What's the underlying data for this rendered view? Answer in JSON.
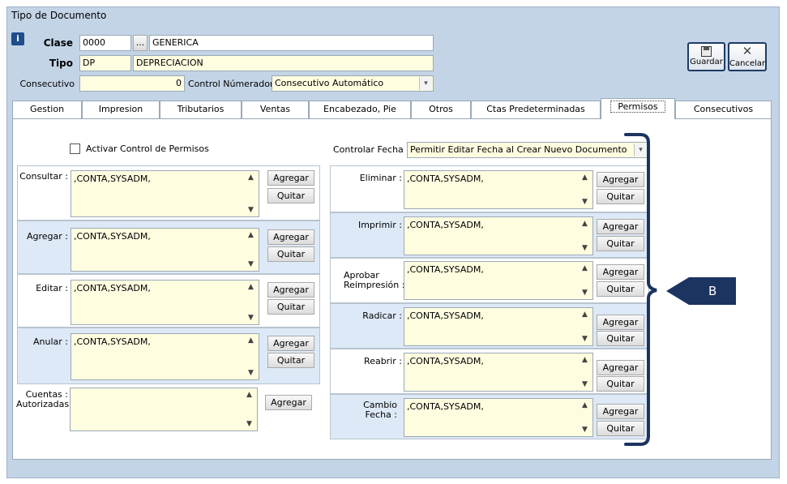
{
  "window": {
    "title": "Tipo de Documento"
  },
  "header": {
    "clase_label": "Clase",
    "clase_code": "0000",
    "clase_lookup_label": "...",
    "clase_name": "GENERICA",
    "tipo_label": "Tipo",
    "tipo_code": "DP",
    "tipo_name": "DEPRECIACION",
    "consecutivo_label": "Consecutivo",
    "consecutivo_value": "0",
    "control_numerador_label": "Control Númerador :",
    "control_numerador_value": "Consecutivo Automático"
  },
  "toolbar": {
    "guardar_label": "Guardar",
    "cancelar_label": "Cancelar"
  },
  "tabs": [
    {
      "label": "Gestion"
    },
    {
      "label": "Impresion"
    },
    {
      "label": "Tributarios"
    },
    {
      "label": "Ventas"
    },
    {
      "label": "Encabezado, Pie"
    },
    {
      "label": "Otros"
    },
    {
      "label": "Ctas Predeterminadas"
    },
    {
      "label": "Permisos",
      "active": true
    },
    {
      "label": "Consecutivos"
    }
  ],
  "permisos": {
    "activar_label": "Activar Control de Permisos",
    "controlar_fecha_label": "Controlar Fecha",
    "controlar_fecha_value": "Permitir Editar Fecha al Crear Nuevo Documento",
    "left": [
      {
        "label": "Consultar :",
        "value": ",CONTA,SYSADM,",
        "agregar": "Agregar",
        "quitar": "Quitar"
      },
      {
        "label": "Agregar :",
        "value": ",CONTA,SYSADM,",
        "agregar": "Agregar",
        "quitar": "Quitar"
      },
      {
        "label": "Editar :",
        "value": ",CONTA,SYSADM,",
        "agregar": "Agregar",
        "quitar": "Quitar"
      },
      {
        "label": "Anular :",
        "value": ",CONTA,SYSADM,",
        "agregar": "Agregar",
        "quitar": "Quitar"
      }
    ],
    "cuentas": {
      "label_line1": "Cuentas :",
      "label_line2": "Autorizadas",
      "value": "",
      "agregar": "Agregar"
    },
    "right": [
      {
        "label_line1": "Eliminar :",
        "label_line2": "",
        "value": ",CONTA,SYSADM,",
        "agregar": "Agregar",
        "quitar": "Quitar"
      },
      {
        "label_line1": "Imprimir :",
        "label_line2": "",
        "value": ",CONTA,SYSADM,",
        "agregar": "Agregar",
        "quitar": "Quitar"
      },
      {
        "label_line1": "Aprobar",
        "label_line2": "Reimpresión :",
        "value": ",CONTA,SYSADM,",
        "agregar": "Agregar",
        "quitar": "Quitar"
      },
      {
        "label_line1": "Radicar :",
        "label_line2": "",
        "value": ",CONTA,SYSADM,",
        "agregar": "Agregar",
        "quitar": "Quitar"
      },
      {
        "label_line1": "Reabrir :",
        "label_line2": "",
        "value": ",CONTA,SYSADM,",
        "agregar": "Agregar",
        "quitar": "Quitar"
      },
      {
        "label_line1": "Cambio",
        "label_line2": "Fecha :",
        "value": ",CONTA,SYSADM,",
        "agregar": "Agregar",
        "quitar": "Quitar"
      }
    ]
  },
  "callout": {
    "label": "B",
    "color": "#1c3460"
  },
  "icons": {
    "info": "info-icon",
    "save": "floppy-disk-icon",
    "cancel": "close-x-icon"
  }
}
